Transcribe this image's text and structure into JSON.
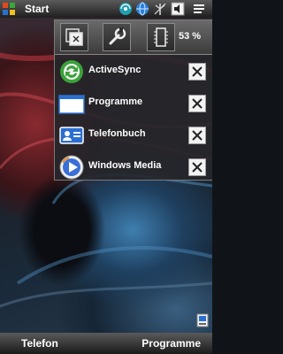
{
  "topbar": {
    "title": "Start",
    "icons": [
      "windows-start-icon",
      "connectivity-globe-icon",
      "network-globe-icon",
      "antenna-off-icon",
      "volume-icon",
      "menu-icon"
    ]
  },
  "panel": {
    "tools": [
      "task-manager-icon",
      "settings-wrench-icon",
      "memory-chip-icon"
    ],
    "battery": "53 %",
    "apps": [
      {
        "label": "ActiveSync",
        "icon": "activesync-icon"
      },
      {
        "label": "Programme",
        "icon": "programs-window-icon"
      },
      {
        "label": "Telefonbuch",
        "icon": "contacts-card-icon"
      },
      {
        "label": "Windows Media",
        "icon": "windows-media-icon"
      }
    ]
  },
  "softkeys": {
    "left": "Telefon",
    "right": "Programme"
  },
  "colors": {
    "panel_bg": "#26262a",
    "close_bg": "#f2f2f2",
    "bar_top": "#5a5a5a",
    "bar_bottom": "#1a1a1a"
  }
}
